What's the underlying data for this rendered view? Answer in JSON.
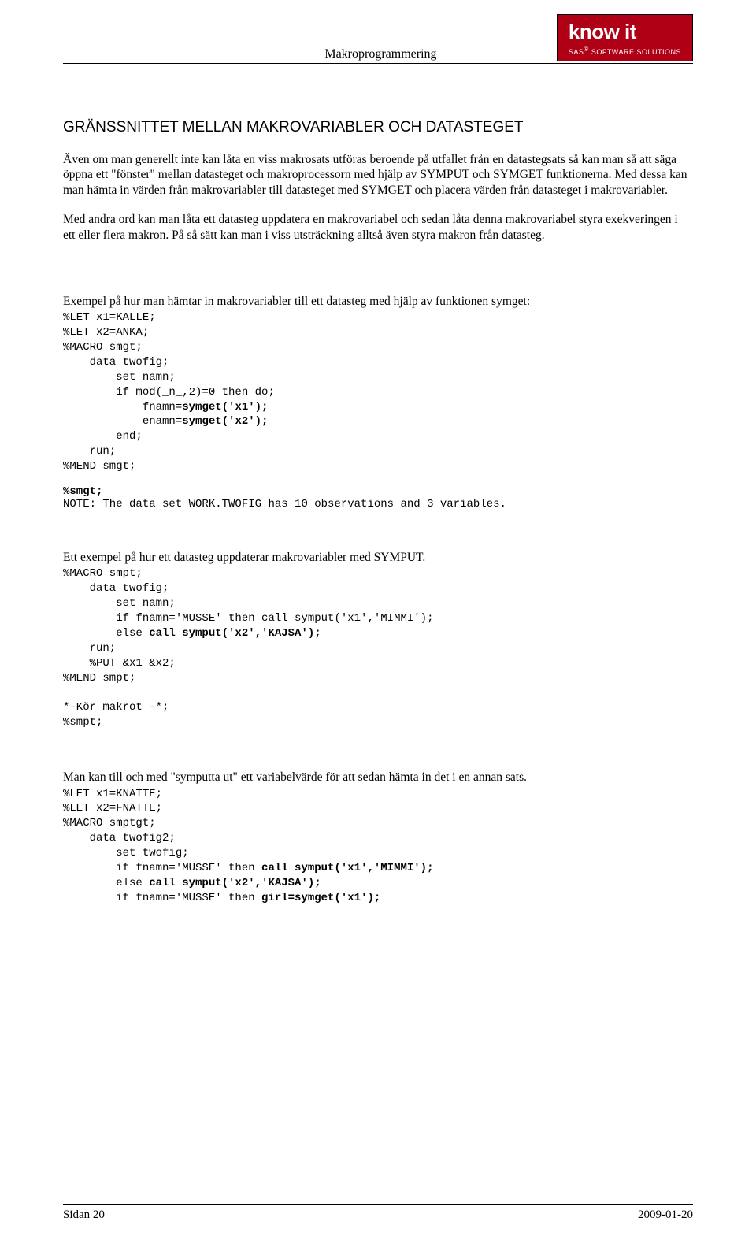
{
  "header": {
    "title": "Makroprogrammering",
    "logo_main": "know it",
    "logo_sub_prefix": "SAS",
    "logo_sub_suffix": " SOFTWARE SOLUTIONS"
  },
  "section_heading": "GRÄNSSNITTET MELLAN MAKROVARIABLER OCH DATASTEGET",
  "para1": "Även om man generellt inte kan låta en viss makrosats utföras beroende på utfallet från en datastegsats så kan man så att säga öppna ett \"fönster\" mellan datasteget och makroprocessorn med hjälp av SYMPUT och SYMGET funktionerna. Med dessa kan man hämta in värden från makrovariabler till datasteget med SYMGET och placera värden från datasteget i makrovariabler.",
  "para2": "Med andra ord kan man låta ett datasteg uppdatera en makrovariabel och sedan låta denna makrovariabel styra exekveringen i ett eller flera makron. På så sätt kan man i viss utsträckning alltså även styra makron från datasteg.",
  "ex1_intro": "Exempel på hur man hämtar in makrovariabler till ett datasteg med hjälp av funktionen symget:",
  "code1": {
    "l1": "%LET x1=KALLE;",
    "l2": "%LET x2=ANKA;",
    "l3": "%MACRO smgt;",
    "l4": "    data twofig;",
    "l5": "        set namn;",
    "l6": "        if mod(_n_,2)=0 then do;",
    "l7a": "            fnamn=",
    "l7b": "symget('x1');",
    "l8a": "            enamn=",
    "l8b": "symget('x2');",
    "l9": "        end;",
    "l10": "    run;",
    "l11": "%MEND smgt;"
  },
  "note1_a": "%smgt;",
  "note1_b": "NOTE: The data set WORK.TWOFIG has 10 observations and 3 variables.",
  "ex2_intro": "Ett exempel på hur ett datasteg uppdaterar makrovariabler med SYMPUT.",
  "code2": {
    "l1": "%MACRO smpt;",
    "l2": "    data twofig;",
    "l3": "        set namn;",
    "l4": "        if fnamn='MUSSE' then call symput('x1','MIMMI');",
    "l5a": "        else ",
    "l5b": "call symput('x2','KAJSA');",
    "l6": "    run;",
    "l7": "    %PUT &x1 &x2;",
    "l8": "%MEND smpt;",
    "l9": "",
    "l10": "*-Kör makrot -*;",
    "l11": "%smpt;"
  },
  "ex3_intro": "Man kan till och med \"symputta ut\" ett variabelvärde för att sedan hämta in det i en annan sats.",
  "code3": {
    "l1": "%LET x1=KNATTE;",
    "l2": "%LET x2=FNATTE;",
    "l3": "%MACRO smptgt;",
    "l4": "    data twofig2;",
    "l5": "        set twofig;",
    "l6a": "        if fnamn='MUSSE' then ",
    "l6b": "call symput('x1','MIMMI');",
    "l7a": "        else ",
    "l7b": "call symput('x2','KAJSA');",
    "l8a": "        if fnamn='MUSSE' then ",
    "l8b": "girl=symget('x1');"
  },
  "footer": {
    "left": "Sidan 20",
    "right": "2009-01-20"
  }
}
